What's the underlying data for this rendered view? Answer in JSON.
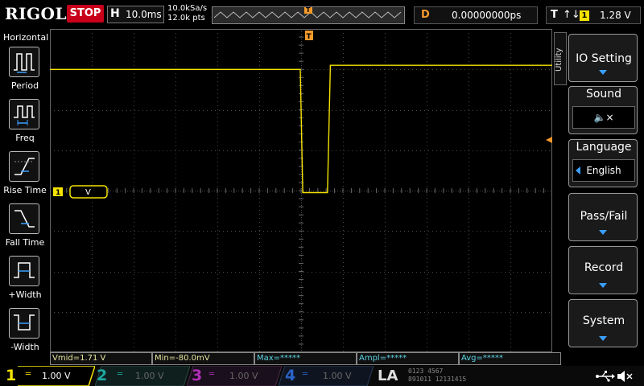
{
  "brand": "RIGOL",
  "run_status": "STOP",
  "timebase": {
    "label": "H",
    "value": "10.0ms"
  },
  "sample": {
    "rate": "10.0kSa/s",
    "points": "12.0k pts"
  },
  "trigger_marker": "T",
  "delay": {
    "label": "D",
    "value": "0.00000000ps"
  },
  "trigger": {
    "label": "T",
    "edge_symbol": "↑↓",
    "source": "1",
    "level": "1.28 V"
  },
  "left_menu": {
    "title": "Horizontal",
    "items": [
      {
        "label": "Period",
        "icon": "period-icon"
      },
      {
        "label": "Freq",
        "icon": "freq-icon"
      },
      {
        "label": "Rise Time",
        "icon": "rise-time-icon"
      },
      {
        "label": "Fall Time",
        "icon": "fall-time-icon"
      },
      {
        "label": "+Width",
        "icon": "pos-width-icon"
      },
      {
        "label": "-Width",
        "icon": "neg-width-icon"
      }
    ]
  },
  "ch1_marker": "1",
  "cursor_label": "V",
  "right_menu": {
    "tab": "Utility",
    "items": [
      {
        "label": "IO Setting"
      },
      {
        "label": "Sound",
        "value": "🔈×"
      },
      {
        "label": "Language",
        "value": "English"
      },
      {
        "label": "Pass/Fail"
      },
      {
        "label": "Record"
      },
      {
        "label": "System"
      }
    ]
  },
  "measurements": [
    "Vmid=1.71 V",
    "Min=-80.0mV",
    "Max=*****",
    "Ampl=*****",
    "Avg=*****"
  ],
  "channels": [
    {
      "num": "1",
      "scale": "1.00 V",
      "color": "#f4e200",
      "active": true
    },
    {
      "num": "2",
      "scale": "1.00 V",
      "color": "#1fa7a0",
      "active": false
    },
    {
      "num": "3",
      "scale": "1.00 V",
      "color": "#b02db8",
      "active": false
    },
    {
      "num": "4",
      "scale": "1.00 V",
      "color": "#2a63c8",
      "active": false
    }
  ],
  "la": {
    "label": "LA",
    "bits_row1": "0123 4567",
    "bits_row2": "891011 12131415"
  },
  "status_icons": [
    "usb-icon",
    "speaker-mute-icon"
  ],
  "colors": {
    "ch1": "#f4e200",
    "grid": "#4a4a4a",
    "accent": "#3aa0ff",
    "trigger": "#f49a2a",
    "measure_text": "#e6e6a0"
  },
  "chart_data": {
    "type": "line",
    "title": "",
    "xlabel": "",
    "ylabel": "",
    "x_divisions": 12,
    "y_divisions": 8,
    "xlim": [
      -60,
      60
    ],
    "ylim": [
      -4,
      4
    ],
    "series": [
      {
        "x": [
          -60,
          -0.2,
          0.4,
          6.3,
          7.0,
          60
        ],
        "y": [
          3.0,
          3.0,
          -0.05,
          -0.05,
          3.1,
          3.1
        ]
      }
    ]
  }
}
